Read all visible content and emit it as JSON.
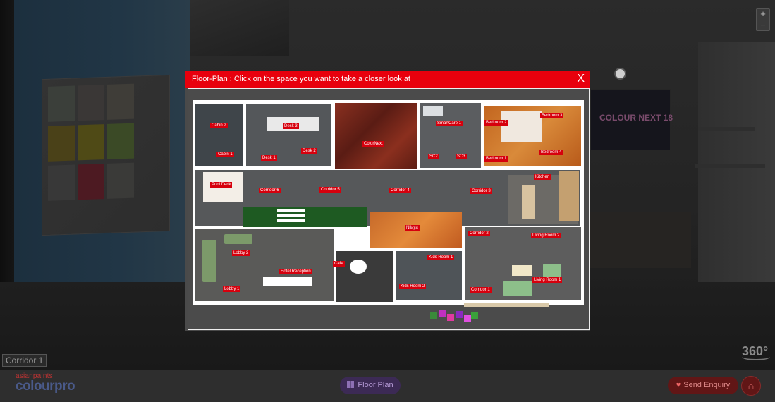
{
  "app": {
    "brand_top": "asianpaints",
    "brand_main": "colourpro"
  },
  "scene": {
    "tv_logo": "COLOUR NEXT 18",
    "location": "Corridor 1",
    "panorama_label": "360°"
  },
  "controls": {
    "zoom_in": "+",
    "zoom_out": "−"
  },
  "modal": {
    "title": "Floor-Plan : Click on the space you want to take a closer look at",
    "close_label": "X"
  },
  "rooms": {
    "cabin2": "Cabin 2",
    "cabin1": "Cabin 1",
    "desk3": "Desk 3",
    "desk1": "Desk 1",
    "desk2": "Desk 2",
    "colornext": "ColorNext",
    "smartcare1": "SmartCare 1",
    "sc2": "SC2",
    "sc3": "SC3",
    "bedroom2": "Bedroom 2",
    "bedroom3": "Bedroom 3",
    "bedroom4": "Bedroom 4",
    "bedroom1": "Bedroom 1",
    "kitchen": "Kitchen",
    "pooldeck": "Pool Deck",
    "corridor6": "Corridor 6",
    "corridor5": "Corridor 5",
    "corridor4": "Corridor 4",
    "corridor3": "Corridor 3",
    "corridor2": "Corridor 2",
    "corridor1": "Corridor 1",
    "nilaya": "Nilaya",
    "livingroom2": "Living Room 2",
    "livingroom1": "Living Room 1",
    "lobby2": "Lobby 2",
    "lobby1": "Lobby 1",
    "hotelreception": "Hotel Reception",
    "cafe": "Cafe",
    "kidsroom1": "Kids Room 1",
    "kidsroom2": "Kids Room 2"
  },
  "bottombar": {
    "floor_plan": "Floor Plan",
    "send_enquiry": "Send Enquiry"
  },
  "colors": {
    "accent_red": "#e8000d",
    "tag_red": "#d6000d",
    "floor_plan_purple": "#3c2a55"
  }
}
